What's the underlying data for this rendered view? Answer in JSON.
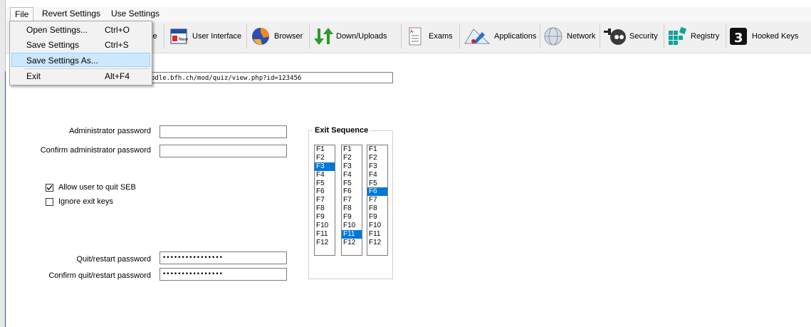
{
  "menu": {
    "items": [
      "File",
      "Revert Settings",
      "Use Settings"
    ]
  },
  "file_menu": {
    "items": [
      {
        "label": "Open Settings...",
        "shortcut": "Ctrl+O"
      },
      {
        "label": "Save Settings",
        "shortcut": "Ctrl+S"
      },
      {
        "label": "Save Settings As...",
        "shortcut": ""
      },
      {
        "label": "Exit",
        "shortcut": "Alt+F4"
      }
    ],
    "highlighted": "Save Settings As..."
  },
  "toolbar": {
    "partial_label": "le",
    "tabs": [
      {
        "label": "User Interface",
        "icon": "user-interface-icon"
      },
      {
        "label": "Browser",
        "icon": "browser-icon"
      },
      {
        "label": "Down/Uploads",
        "icon": "down-uploads-icon"
      },
      {
        "label": "Exams",
        "icon": "exams-icon"
      },
      {
        "label": "Applications",
        "icon": "applications-icon"
      },
      {
        "label": "Network",
        "icon": "network-icon"
      },
      {
        "label": "Security",
        "icon": "security-icon"
      },
      {
        "label": "Registry",
        "icon": "registry-icon"
      },
      {
        "label": "Hooked Keys",
        "icon": "hooked-keys-icon"
      }
    ]
  },
  "start_url": {
    "value": "odle.bfh.ch/mod/quiz/view.php?id=123456"
  },
  "admin": {
    "password_label": "Administrator password",
    "confirm_label": "Confirm administrator password",
    "password_value": "",
    "confirm_value": ""
  },
  "options": {
    "allow_quit_label": "Allow user to quit SEB",
    "allow_quit_checked": true,
    "ignore_exit_label": "Ignore exit keys",
    "ignore_exit_checked": false
  },
  "quit": {
    "password_label": "Quit/restart password",
    "confirm_label": "Confirm quit/restart password",
    "password_value": "••••••••••••••••",
    "confirm_value": "••••••••••••••••"
  },
  "exit_sequence": {
    "title": "Exit Sequence",
    "keys": [
      "F1",
      "F2",
      "F3",
      "F4",
      "F5",
      "F6",
      "F7",
      "F8",
      "F9",
      "F10",
      "F11",
      "F12"
    ],
    "selected": [
      "F3",
      "F11",
      "F6"
    ]
  },
  "colors": {
    "selection": "#0078d7",
    "menu_highlight": "#cce8ff"
  }
}
